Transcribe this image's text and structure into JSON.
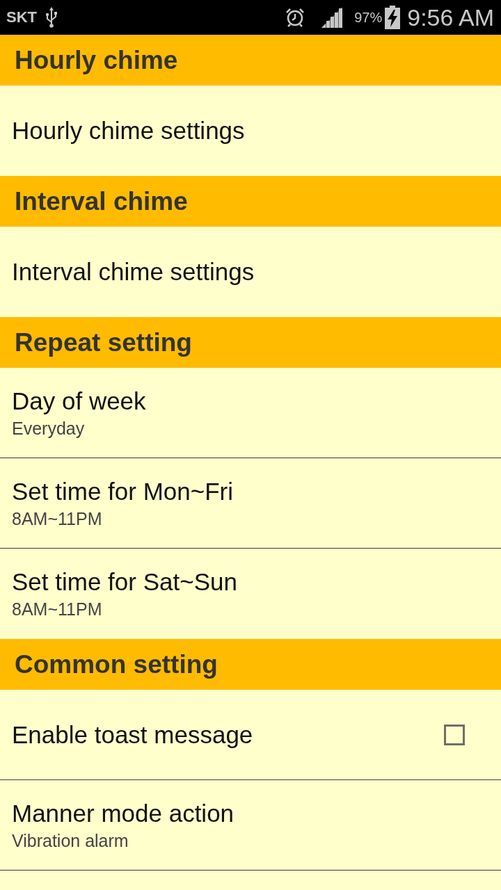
{
  "status_bar": {
    "carrier": "SKT",
    "battery_percent": "97%",
    "time": "9:56 AM"
  },
  "sections": [
    {
      "title": "Hourly chime",
      "items": [
        {
          "kind": "link",
          "title": "Hourly chime settings"
        }
      ]
    },
    {
      "title": "Interval chime",
      "items": [
        {
          "kind": "link",
          "title": "Interval chime settings"
        }
      ]
    },
    {
      "title": "Repeat setting",
      "items": [
        {
          "kind": "link",
          "title": "Day of week",
          "summary": "Everyday"
        },
        {
          "kind": "link",
          "title": "Set time for Mon~Fri",
          "summary": "8AM~11PM"
        },
        {
          "kind": "link",
          "title": "Set time for Sat~Sun",
          "summary": "8AM~11PM"
        }
      ]
    },
    {
      "title": "Common setting",
      "items": [
        {
          "kind": "checkbox",
          "title": "Enable toast message",
          "checked": false
        },
        {
          "kind": "link",
          "title": "Manner mode action",
          "summary": "Vibration alarm"
        }
      ]
    }
  ]
}
